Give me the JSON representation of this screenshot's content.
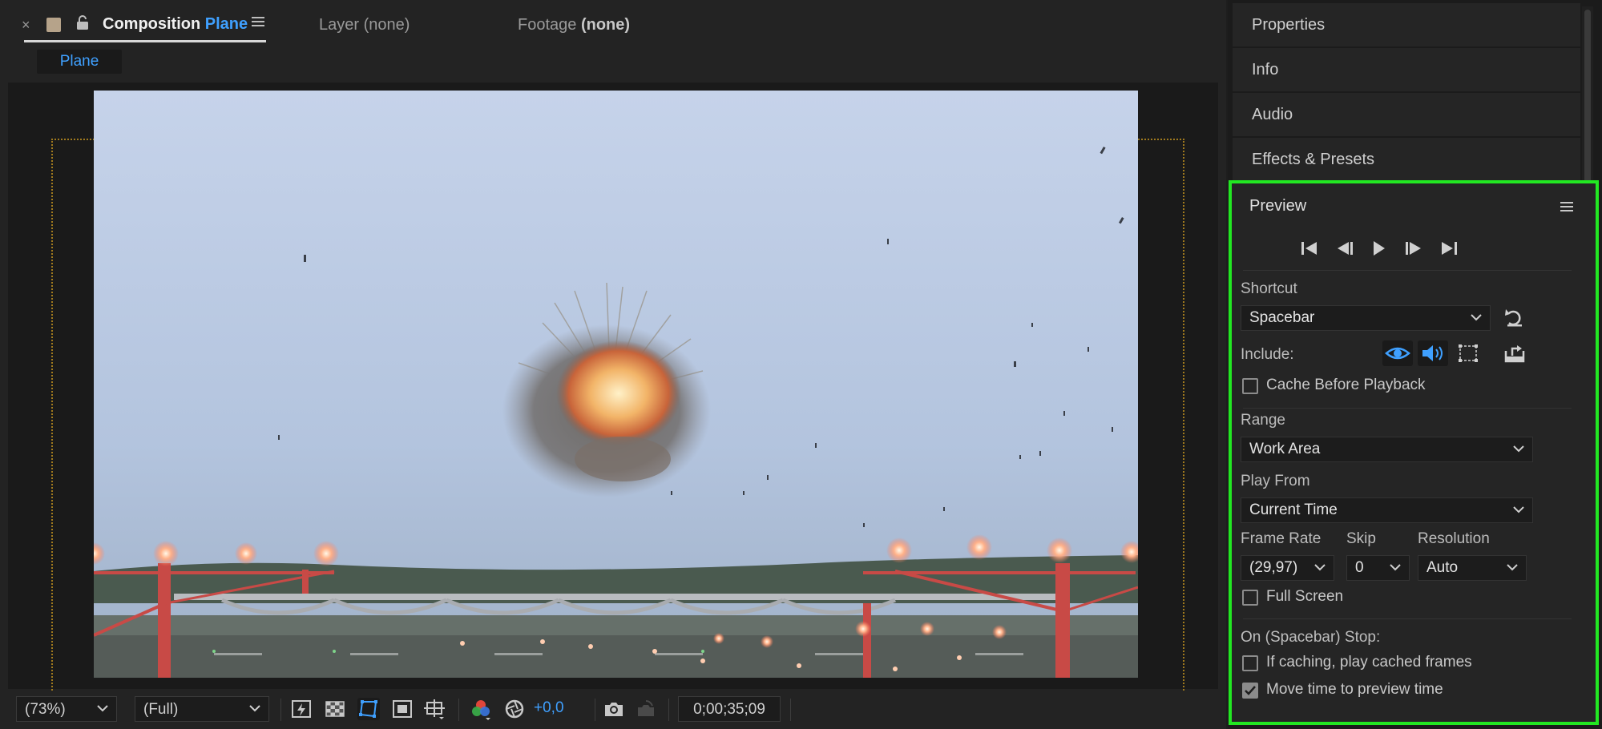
{
  "composition": {
    "tab": {
      "close": "×",
      "prefix": "Composition",
      "name": "Plane"
    },
    "layer_tab": "Layer (none)",
    "footage_tab": {
      "prefix": "Footage",
      "value": "(none)"
    },
    "breadcrumb": "Plane"
  },
  "viewer_toolbar": {
    "zoom": "(73%)",
    "resolution": "(Full)",
    "exposure": "+0,0",
    "timecode": "0;00;35;09"
  },
  "panels": {
    "properties": "Properties",
    "info": "Info",
    "audio": "Audio",
    "effects": "Effects & Presets"
  },
  "preview": {
    "title": "Preview",
    "shortcut_label": "Shortcut",
    "shortcut_value": "Spacebar",
    "include_label": "Include:",
    "cache_before_playback": {
      "label": "Cache Before Playback",
      "checked": false
    },
    "range_label": "Range",
    "range_value": "Work Area",
    "play_from_label": "Play From",
    "play_from_value": "Current Time",
    "frame_rate_label": "Frame Rate",
    "frame_rate_value": "(29,97)",
    "skip_label": "Skip",
    "skip_value": "0",
    "resolution_label": "Resolution",
    "resolution_value": "Auto",
    "full_screen": {
      "label": "Full Screen",
      "checked": false
    },
    "on_stop_label": "On (Spacebar) Stop:",
    "if_caching": {
      "label": "If caching, play cached frames",
      "checked": false
    },
    "move_time": {
      "label": "Move time to preview time",
      "checked": true
    }
  },
  "colors": {
    "accent": "#3fa0ff",
    "highlight_border": "#22e822"
  }
}
